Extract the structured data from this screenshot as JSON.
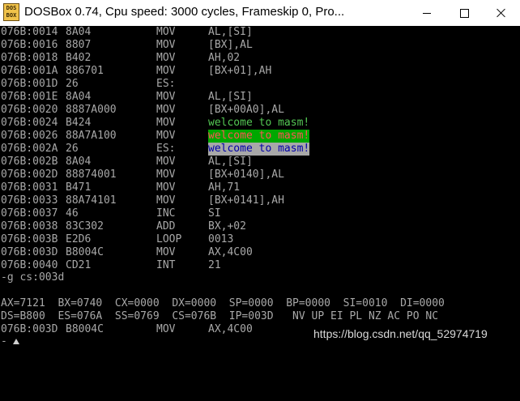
{
  "window": {
    "title": "DOSBox 0.74, Cpu speed:     3000 cycles, Frameskip  0, Pro...",
    "icon_text_top": "DOS",
    "icon_text_bottom": "BOX"
  },
  "disassembly": [
    {
      "addr": "076B:0014",
      "hex": "8A04",
      "mnemonic": "MOV",
      "operand": "AL,[SI]"
    },
    {
      "addr": "076B:0016",
      "hex": "8807",
      "mnemonic": "MOV",
      "operand": "[BX],AL"
    },
    {
      "addr": "076B:0018",
      "hex": "B402",
      "mnemonic": "MOV",
      "operand": "AH,02"
    },
    {
      "addr": "076B:001A",
      "hex": "886701",
      "mnemonic": "MOV",
      "operand": "[BX+01],AH"
    },
    {
      "addr": "076B:001D",
      "hex": "26",
      "mnemonic": "ES:",
      "operand": ""
    },
    {
      "addr": "076B:001E",
      "hex": "8A04",
      "mnemonic": "MOV",
      "operand": "AL,[SI]"
    },
    {
      "addr": "076B:0020",
      "hex": "8887A000",
      "mnemonic": "MOV",
      "operand": "[BX+00A0],AL"
    },
    {
      "addr": "076B:0024",
      "hex": "B424",
      "mnemonic": "MOV",
      "operand": "welcome to masm!",
      "style": "green"
    },
    {
      "addr": "076B:0026",
      "hex": "88A7A100",
      "mnemonic": "MOV",
      "operand": "welcome to masm!",
      "style": "red-on-green"
    },
    {
      "addr": "076B:002A",
      "hex": "26",
      "mnemonic": "ES:",
      "operand": "welcome to masm!",
      "style": "blue-on-white"
    },
    {
      "addr": "076B:002B",
      "hex": "8A04",
      "mnemonic": "MOV",
      "operand": "AL,[SI]"
    },
    {
      "addr": "076B:002D",
      "hex": "88874001",
      "mnemonic": "MOV",
      "operand": "[BX+0140],AL"
    },
    {
      "addr": "076B:0031",
      "hex": "B471",
      "mnemonic": "MOV",
      "operand": "AH,71"
    },
    {
      "addr": "076B:0033",
      "hex": "88A74101",
      "mnemonic": "MOV",
      "operand": "[BX+0141],AH"
    },
    {
      "addr": "076B:0037",
      "hex": "46",
      "mnemonic": "INC",
      "operand": "SI"
    },
    {
      "addr": "076B:0038",
      "hex": "83C302",
      "mnemonic": "ADD",
      "operand": "BX,+02"
    },
    {
      "addr": "076B:003B",
      "hex": "E2D6",
      "mnemonic": "LOOP",
      "operand": "0013"
    },
    {
      "addr": "076B:003D",
      "hex": "B8004C",
      "mnemonic": "MOV",
      "operand": "AX,4C00"
    },
    {
      "addr": "076B:0040",
      "hex": "CD21",
      "mnemonic": "INT",
      "operand": "21"
    }
  ],
  "command": "-g cs:003d",
  "registers": {
    "line1": "AX=7121  BX=0740  CX=0000  DX=0000  SP=0000  BP=0000  SI=0010  DI=0000",
    "line2": "DS=B800  ES=076A  SS=0769  CS=076B  IP=003D   NV UP EI PL NZ AC PO NC"
  },
  "current_instruction": {
    "addr": "076B:003D",
    "hex": "B8004C",
    "mnemonic": "MOV",
    "operand": "AX,4C00"
  },
  "cursor_prompt": "-",
  "watermark": "https://blog.csdn.net/qq_52974719",
  "colors": {
    "console_bg": "#000000",
    "console_fg": "#a8a8a8",
    "highlight_green": "#54c854",
    "highlight_red": "#ff5454",
    "highlight_blue": "#0000a8"
  }
}
